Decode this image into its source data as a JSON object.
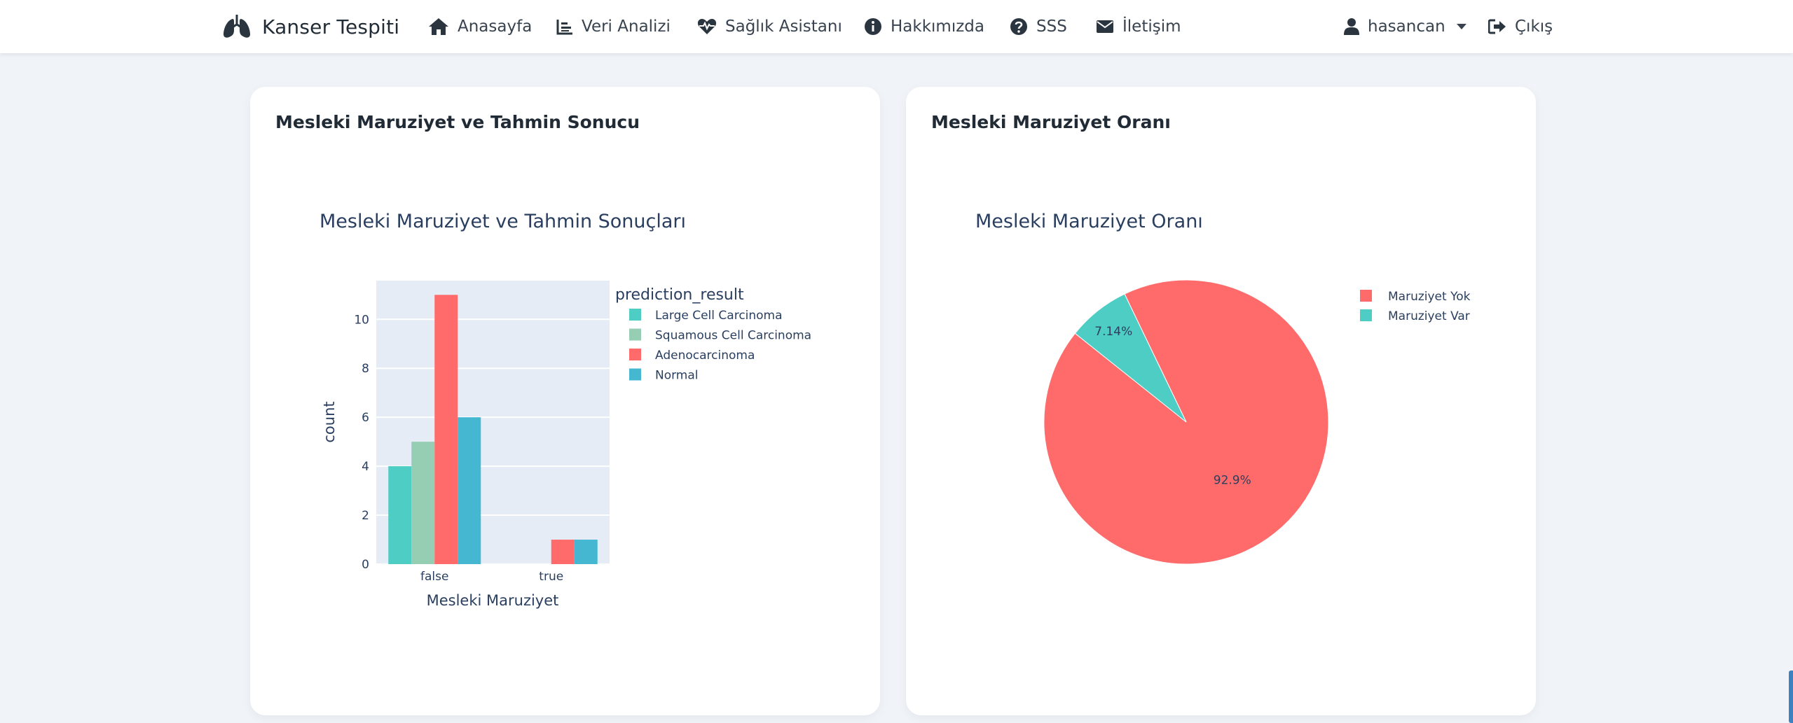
{
  "navbar": {
    "brand": "Kanser Tespiti",
    "links": [
      {
        "label": "Anasayfa",
        "icon": "home-icon"
      },
      {
        "label": "Veri Analizi",
        "icon": "chart-area-icon"
      },
      {
        "label": "Sağlık Asistanı",
        "icon": "heart-pulse-icon"
      },
      {
        "label": "Hakkımızda",
        "icon": "info-circle-icon"
      },
      {
        "label": "SSS",
        "icon": "question-circle-icon"
      },
      {
        "label": "İletişim",
        "icon": "envelope-icon"
      }
    ],
    "user": {
      "label": "hasancan",
      "icon": "user-icon"
    },
    "logout": {
      "label": "Çıkış",
      "icon": "sign-out-icon"
    }
  },
  "cards": {
    "left_title": "Mesleki Maruziyet ve Tahmin Sonucu",
    "right_title": "Mesleki Maruziyet Oranı"
  },
  "colors": {
    "bar_plot_bg": "#e5ecf6",
    "Large Cell Carcinoma": "#4ecdc4",
    "Squamous Cell Carcinoma": "#96ceb4",
    "Adenocarcinoma": "#ff6b6b",
    "Normal": "#45b7d1",
    "pie_no": "#ff6b6b",
    "pie_yes": "#4ecdc4"
  },
  "chart_data": [
    {
      "type": "bar",
      "title": "Mesleki Maruziyet ve Tahmin Sonuçları",
      "xlabel": "Mesleki Maruziyet",
      "ylabel": "count",
      "categories": [
        "false",
        "true"
      ],
      "legend_title": "prediction_result",
      "series": [
        {
          "name": "Large Cell Carcinoma",
          "values": [
            4,
            0
          ]
        },
        {
          "name": "Squamous Cell Carcinoma",
          "values": [
            5,
            0
          ]
        },
        {
          "name": "Adenocarcinoma",
          "values": [
            11,
            1
          ]
        },
        {
          "name": "Normal",
          "values": [
            6,
            1
          ]
        }
      ],
      "yticks": [
        "0",
        "2",
        "4",
        "6",
        "8",
        "10"
      ],
      "ylim": [
        0,
        11.58
      ],
      "grid": true,
      "legend_position": "right"
    },
    {
      "type": "pie",
      "title": "Mesleki Maruziyet Oranı",
      "slices": [
        {
          "name": "Maruziyet Yok",
          "value": 92.9,
          "label": "92.9%"
        },
        {
          "name": "Maruziyet Var",
          "value": 7.14,
          "label": "7.14%"
        }
      ],
      "legend_position": "right"
    }
  ]
}
